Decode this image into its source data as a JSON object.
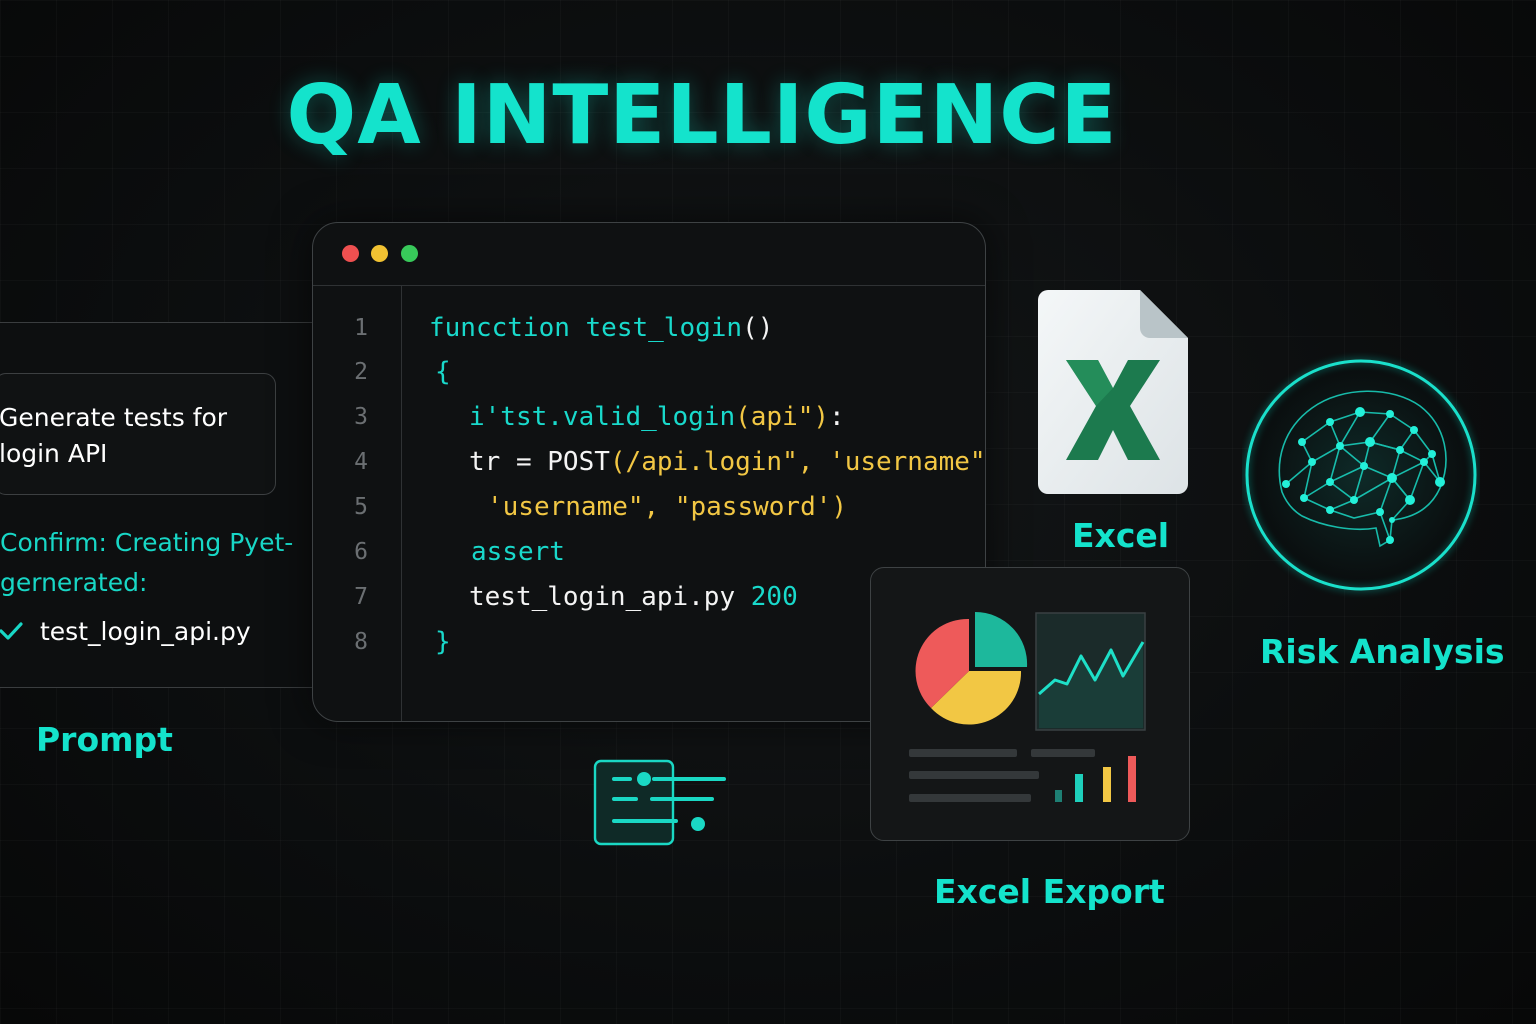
{
  "title": "QA INTELLIGENCE",
  "prompt": {
    "input_text": "Generate tests for\nlogin API",
    "confirm_text": "Confirm: Creating Pyet-\ngernerated:",
    "file_name": "test_login_api.py",
    "label": "Prompt"
  },
  "editor": {
    "line_numbers": [
      "1",
      "2",
      "3",
      "4",
      "5",
      "6",
      "7",
      "8"
    ],
    "lines": [
      {
        "parts": [
          {
            "t": "funcction test_login",
            "c": "cyan"
          },
          {
            "t": "()",
            "c": "white"
          }
        ]
      },
      {
        "parts": [
          {
            "t": "{",
            "c": "cyan"
          }
        ]
      },
      {
        "parts": [
          {
            "t": "i'tst.valid_login",
            "c": "cyan"
          },
          {
            "t": "(api\")",
            "c": "yellow"
          },
          {
            "t": ":",
            "c": "white"
          }
        ]
      },
      {
        "parts": [
          {
            "t": "tr = POST",
            "c": "white"
          },
          {
            "t": "(/api.login\", 'username\"",
            "c": "yellow"
          },
          {
            "t": ",",
            "c": "white"
          }
        ]
      },
      {
        "parts": [
          {
            "t": "'username\", \"password')",
            "c": "yellow"
          }
        ]
      },
      {
        "parts": [
          {
            "t": "assert",
            "c": "cyan"
          }
        ]
      },
      {
        "parts": [
          {
            "t": "test_login_api.py ",
            "c": "white"
          },
          {
            "t": "200",
            "c": "cyan"
          }
        ]
      },
      {
        "parts": [
          {
            "t": "}",
            "c": "cyan"
          }
        ]
      }
    ]
  },
  "excel": {
    "label": "Excel",
    "icon": "excel-icon"
  },
  "risk": {
    "label": "Risk Analysis",
    "icon": "brain-network-icon"
  },
  "export": {
    "label": "Excel Export"
  },
  "colors": {
    "accent": "#14e3cc",
    "yellow": "#f2c744",
    "red": "#ee5a5a",
    "teal": "#1db89c",
    "background": "#0c0e0f"
  }
}
